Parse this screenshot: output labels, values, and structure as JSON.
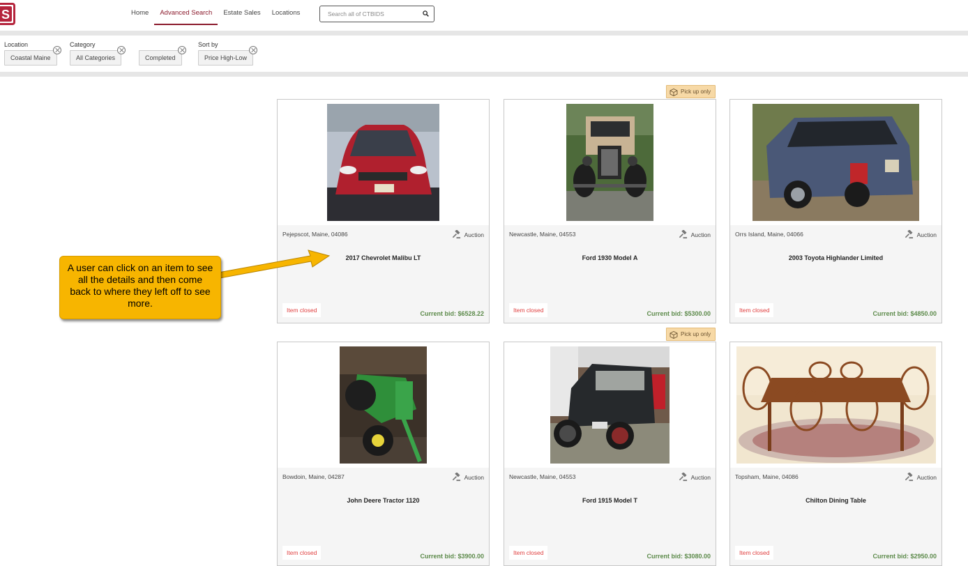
{
  "header": {
    "logo_text": "S",
    "nav": [
      {
        "label": "Home",
        "active": false
      },
      {
        "label": "Advanced Search",
        "active": true
      },
      {
        "label": "Estate Sales",
        "active": false
      },
      {
        "label": "Locations",
        "active": false
      }
    ],
    "search": {
      "placeholder": "Search all of CTBIDS",
      "value": ""
    }
  },
  "filters": [
    {
      "label": "Location",
      "value": "Coastal Maine"
    },
    {
      "label": "Category",
      "value": "All Categories"
    },
    {
      "label": "",
      "value": "Completed"
    },
    {
      "label": "Sort by",
      "value": "Price High-Low"
    }
  ],
  "pickup_label": "Pick up only",
  "items": [
    {
      "location": "Pejepscot, Maine, 04086",
      "type": "Auction",
      "title": "2017 Chevrolet Malibu LT",
      "status": "Item closed",
      "bid": "Current bid: $6528.22",
      "pickup_only": false
    },
    {
      "location": "Newcastle, Maine, 04553",
      "type": "Auction",
      "title": "Ford 1930 Model A",
      "status": "Item closed",
      "bid": "Current bid: $5300.00",
      "pickup_only": true
    },
    {
      "location": "Orrs Island, Maine, 04066",
      "type": "Auction",
      "title": "2003 Toyota Highlander Limited",
      "status": "Item closed",
      "bid": "Current bid: $4850.00",
      "pickup_only": false
    },
    {
      "location": "Bowdoin, Maine, 04287",
      "type": "Auction",
      "title": "John Deere Tractor 1120",
      "status": "Item closed",
      "bid": "Current bid: $3900.00",
      "pickup_only": false
    },
    {
      "location": "Newcastle, Maine, 04553",
      "type": "Auction",
      "title": "Ford 1915 Model T",
      "status": "Item closed",
      "bid": "Current bid: $3080.00",
      "pickup_only": true
    },
    {
      "location": "Topsham, Maine, 04086",
      "type": "Auction",
      "title": "Chilton Dining Table",
      "status": "Item closed",
      "bid": "Current bid: $2950.00",
      "pickup_only": false
    }
  ],
  "callout": {
    "text": "A user can click on an item to see all the details and then come back to where they left off to see more."
  },
  "colors": {
    "brand": "#8b1a2c",
    "callout": "#f7b500",
    "bid": "#5c8a4a",
    "closed": "#e04040",
    "pickup": "#f7d9a6"
  }
}
